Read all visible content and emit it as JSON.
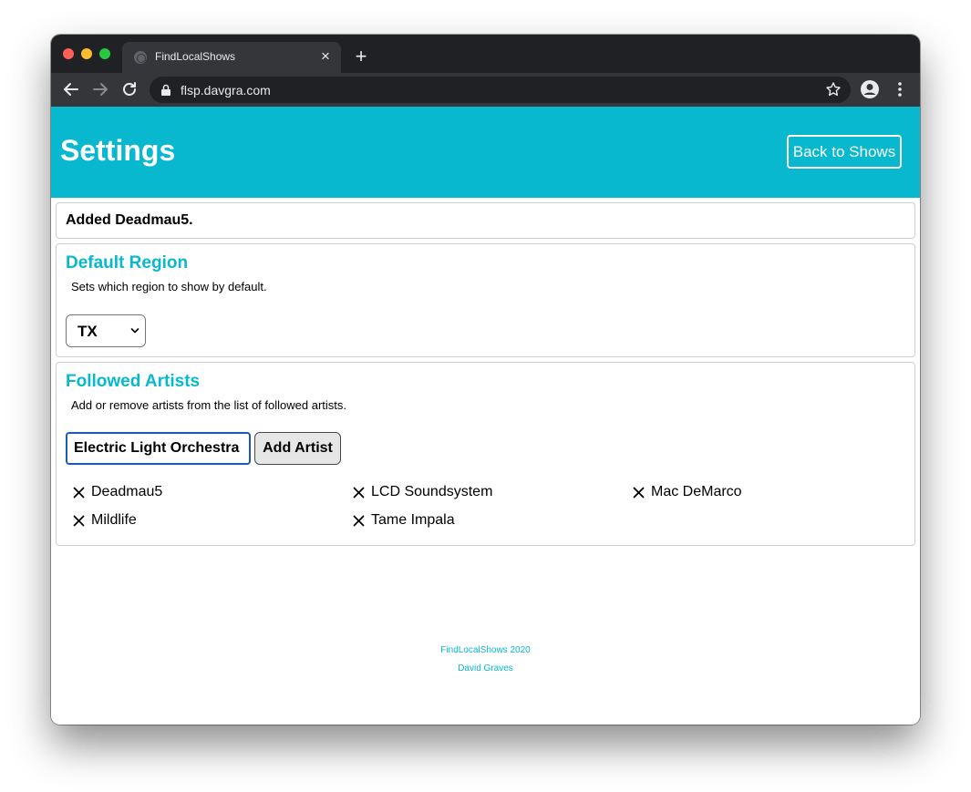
{
  "browser": {
    "tab_title": "FindLocalShows",
    "new_tab_symbol": "+",
    "close_symbol": "×",
    "url": "flsp.davgra.com"
  },
  "header": {
    "title": "Settings",
    "back_button": "Back to Shows"
  },
  "flash": {
    "message": "Added Deadmau5."
  },
  "default_region": {
    "title": "Default Region",
    "description": "Sets which region to show by default.",
    "selected": "TX"
  },
  "followed_artists": {
    "title": "Followed Artists",
    "description": "Add or remove artists from the list of followed artists.",
    "input_value": "Electric Light Orchestra",
    "add_button": "Add Artist",
    "artists": [
      "Deadmau5",
      "LCD Soundsystem",
      "Mac DeMarco",
      "Mildlife",
      "Tame Impala"
    ]
  },
  "footer": {
    "line1": "FindLocalShows 2020",
    "line2": "David Graves"
  },
  "colors": {
    "accent": "#07b8cf",
    "chrome_dark": "#202124",
    "chrome_toolbar": "#35363a",
    "input_focus": "#1a5bb8"
  }
}
